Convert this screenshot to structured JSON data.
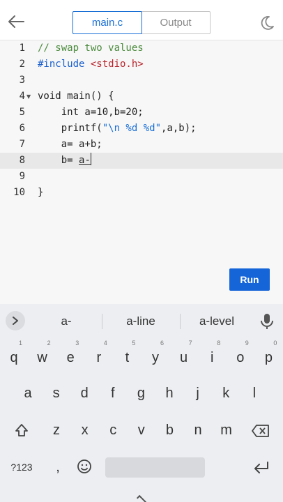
{
  "header": {
    "tabs": [
      {
        "label": "main.c",
        "active": true
      },
      {
        "label": "Output",
        "active": false
      }
    ]
  },
  "editor": {
    "current_line": 8,
    "lines": [
      {
        "num": "1",
        "parts": [
          {
            "t": "// swap two values",
            "c": "comment"
          }
        ]
      },
      {
        "num": "2",
        "parts": [
          {
            "t": "#include ",
            "c": "kw"
          },
          {
            "t": "<stdio.h>",
            "c": "inc"
          }
        ]
      },
      {
        "num": "3",
        "parts": []
      },
      {
        "num": "4",
        "fold": true,
        "parts": [
          {
            "t": "void main() {",
            "c": "plain"
          }
        ]
      },
      {
        "num": "5",
        "parts": [
          {
            "t": "    int a=10,b=20;",
            "c": "plain"
          }
        ]
      },
      {
        "num": "6",
        "parts": [
          {
            "t": "    printf(",
            "c": "plain"
          },
          {
            "t": "\"\\n %d %d\"",
            "c": "str"
          },
          {
            "t": ",a,b);",
            "c": "plain"
          }
        ]
      },
      {
        "num": "7",
        "parts": [
          {
            "t": "    a= a+b;",
            "c": "plain"
          }
        ]
      },
      {
        "num": "8",
        "parts": [
          {
            "t": "    b= ",
            "c": "plain"
          },
          {
            "t": "a-",
            "c": "underline"
          }
        ],
        "caret": true
      },
      {
        "num": "9",
        "parts": []
      },
      {
        "num": "10",
        "parts": [
          {
            "t": "}",
            "c": "plain"
          }
        ]
      }
    ],
    "run_label": "Run"
  },
  "keyboard": {
    "suggestions": [
      "a-",
      "a-line",
      "a-level"
    ],
    "row1": [
      {
        "k": "q",
        "h": "1"
      },
      {
        "k": "w",
        "h": "2"
      },
      {
        "k": "e",
        "h": "3"
      },
      {
        "k": "r",
        "h": "4"
      },
      {
        "k": "t",
        "h": "5"
      },
      {
        "k": "y",
        "h": "6"
      },
      {
        "k": "u",
        "h": "7"
      },
      {
        "k": "i",
        "h": "8"
      },
      {
        "k": "o",
        "h": "9"
      },
      {
        "k": "p",
        "h": "0"
      }
    ],
    "row2": [
      "a",
      "s",
      "d",
      "f",
      "g",
      "h",
      "j",
      "k",
      "l"
    ],
    "row3": [
      "z",
      "x",
      "c",
      "v",
      "b",
      "n",
      "m"
    ],
    "symbols_label": "?123",
    "comma_label": ","
  },
  "colors": {
    "accent": "#1a6fd6",
    "run_button": "#1565d8",
    "comment": "#4a8a3c",
    "keyword": "#1a5fcc",
    "include": "#b8242b"
  }
}
